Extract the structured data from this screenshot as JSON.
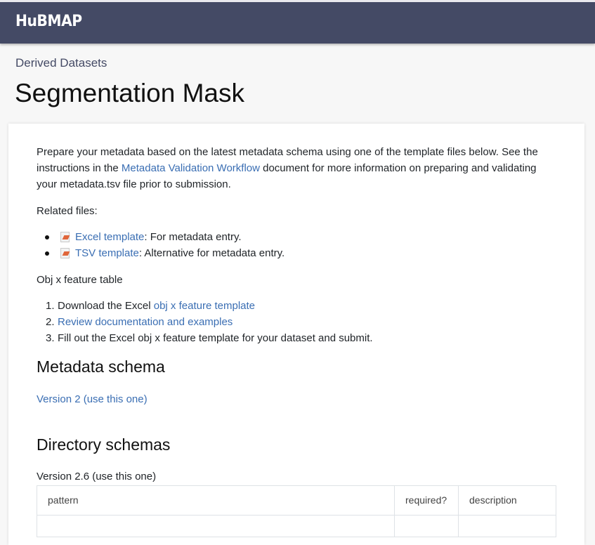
{
  "header": {
    "brand": "HuBMAP"
  },
  "breadcrumb": "Derived Datasets",
  "page_title": "Segmentation Mask",
  "intro": {
    "before_link": "Prepare your metadata based on the latest metadata schema using one of the template files below. See the instructions in the ",
    "link": "Metadata Validation Workflow",
    "after_link": " document for more information on preparing and validating your metadata.tsv file prior to submission."
  },
  "related_files_label": "Related files:",
  "related_files": [
    {
      "link": "Excel template",
      "desc": ": For metadata entry.",
      "icon": "file-icon"
    },
    {
      "link": "TSV template",
      "desc": ": Alternative for metadata entry.",
      "icon": "file-icon"
    }
  ],
  "obj_table_label": "Obj x feature table",
  "steps": [
    {
      "num": "1.",
      "prefix": "Download the Excel ",
      "link": "obj x feature template",
      "suffix": ""
    },
    {
      "num": "2.",
      "prefix": "",
      "link": "Review documentation and examples",
      "suffix": ""
    },
    {
      "num": "3.",
      "prefix": "Fill out the Excel obj x feature template for your dataset and submit.",
      "link": "",
      "suffix": ""
    }
  ],
  "metadata_schema": {
    "heading": "Metadata schema",
    "version_link": "Version 2 (use this one)"
  },
  "directory_schemas": {
    "heading": "Directory schemas",
    "version_label": "Version 2.6 (use this one)",
    "columns": [
      "pattern",
      "required?",
      "description"
    ]
  },
  "colors": {
    "header_bg": "#444a65",
    "link": "#3a6eb3",
    "page_bg": "#f7f7f7"
  }
}
